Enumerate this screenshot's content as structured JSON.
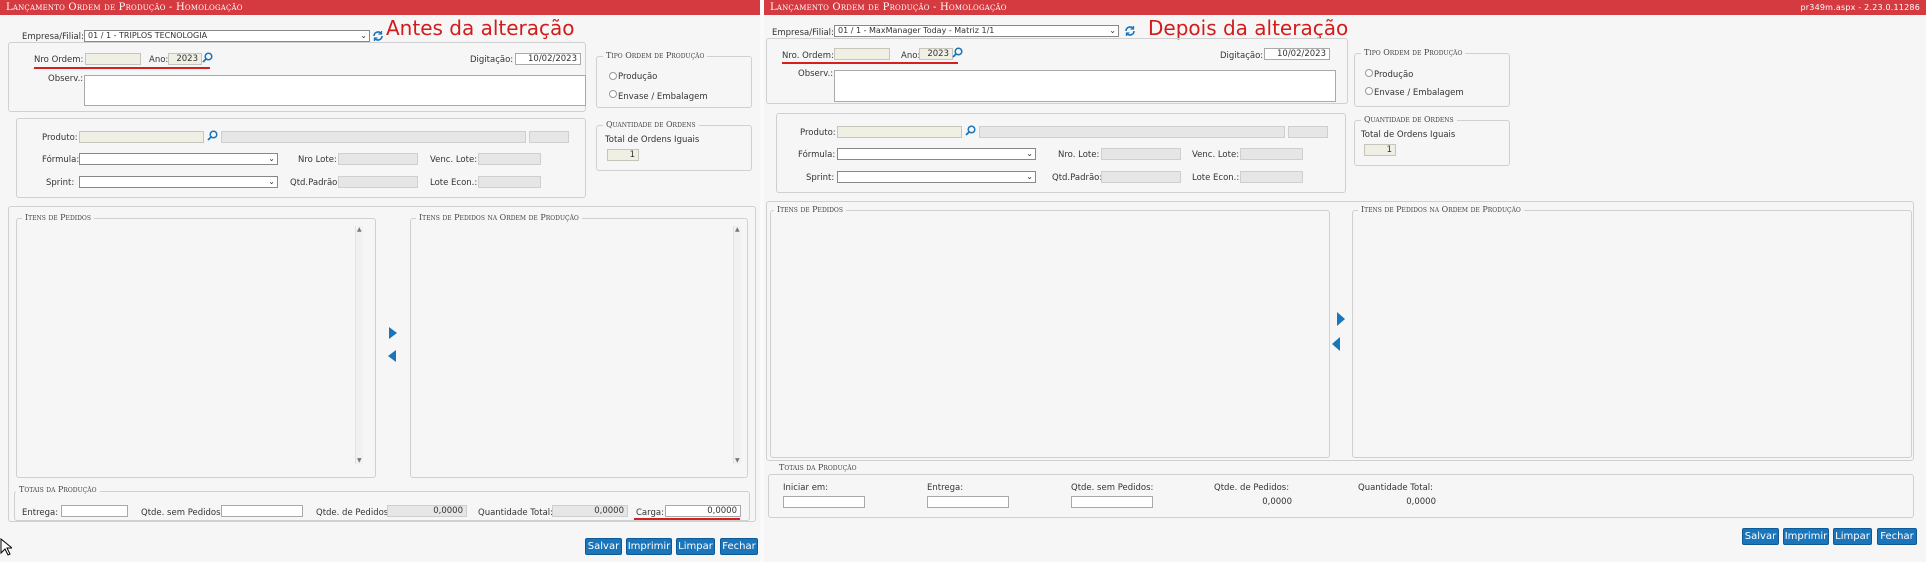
{
  "colors": {
    "titlebar": "#d43a40",
    "button": "#1b75bb",
    "annotation": "#d21c1c"
  },
  "left": {
    "title": "Lançamento Ordem de Produção  - Homologação",
    "annotation": "Antes da alteração",
    "empresa_label": "Empresa/Filial:",
    "empresa_value": "01 / 1 - TRIPLOS TECNOLOGIA",
    "nro_label": "Nro Ordem:",
    "ano_label": "Ano:",
    "ano_value": "2023",
    "digitacao_label": "Digitação:",
    "digitacao_value": "10/02/2023",
    "observ_label": "Observ.:",
    "produto_label": "Produto:",
    "formula_label": "Fórmula:",
    "sprint_label": "Sprint:",
    "nro_lote_label": "Nro Lote:",
    "venc_lote_label": "Venc. Lote:",
    "qtd_padrao_label": "Qtd.Padrão:",
    "lote_econ_label": "Lote Econ.:",
    "tipo_legend": "Tipo Ordem de Produção",
    "radio_producao": "Produção",
    "radio_envase": "Envase / Embalagem",
    "qtd_legend": "Quantidade de Ordens",
    "total_ordens_label": "Total de Ordens Iguais",
    "total_ordens_value": "1",
    "itens_legend": "Itens de Pedidos",
    "itens_ordem_legend": "Itens de Pedidos na Ordem de Produção",
    "totais_legend": "Totais da Produção",
    "entrega_label": "Entrega:",
    "qtde_sem_label": "Qtde. sem Pedidos:",
    "qtde_ped_label": "Qtde. de Pedidos:",
    "qtde_ped_value": "0,0000",
    "qtd_total_label": "Quantidade Total:",
    "qtd_total_value": "0,0000",
    "carga_label": "Carga:",
    "carga_value": "0,0000",
    "buttons": {
      "salvar": "Salvar",
      "imprimir": "Imprimir",
      "limpar": "Limpar",
      "fechar": "Fechar"
    }
  },
  "right": {
    "title": "Lançamento Ordem de Produção  - Homologação",
    "version": "pr349m.aspx - 2.23.0.11286",
    "annotation": "Depois da alteração",
    "empresa_label": "Empresa/Filial:",
    "empresa_value": "01 / 1 - MaxManager Today - Matriz 1/1",
    "nro_label": "Nro. Ordem:",
    "ano_label": "Ano:",
    "ano_value": "2023",
    "digitacao_label": "Digitação:",
    "digitacao_value": "10/02/2023",
    "observ_label": "Observ.:",
    "produto_label": "Produto:",
    "formula_label": "Fórmula:",
    "sprint_label": "Sprint:",
    "nro_lote_label": "Nro. Lote:",
    "venc_lote_label": "Venc. Lote:",
    "qtd_padrao_label": "Qtd.Padrão:",
    "lote_econ_label": "Lote Econ.:",
    "tipo_legend": "Tipo Ordem de Produção",
    "radio_producao": "Produção",
    "radio_envase": "Envase / Embalagem",
    "qtd_legend": "Quantidade de Ordens",
    "total_ordens_label": "Total de Ordens Iguais",
    "total_ordens_value": "1",
    "itens_legend": "Itens de Pedidos",
    "itens_ordem_legend": "Itens de Pedidos na Ordem de Produção",
    "totais_legend": "Totais da Produção",
    "iniciar_label": "Iniciar em:",
    "entrega_label": "Entrega:",
    "qtde_sem_label": "Qtde. sem Pedidos:",
    "qtde_ped_label": "Qtde. de Pedidos:",
    "qtde_ped_value": "0,0000",
    "qtd_total_label": "Quantidade Total:",
    "qtd_total_value": "0,0000",
    "buttons": {
      "salvar": "Salvar",
      "imprimir": "Imprimir",
      "limpar": "Limpar",
      "fechar": "Fechar"
    }
  }
}
